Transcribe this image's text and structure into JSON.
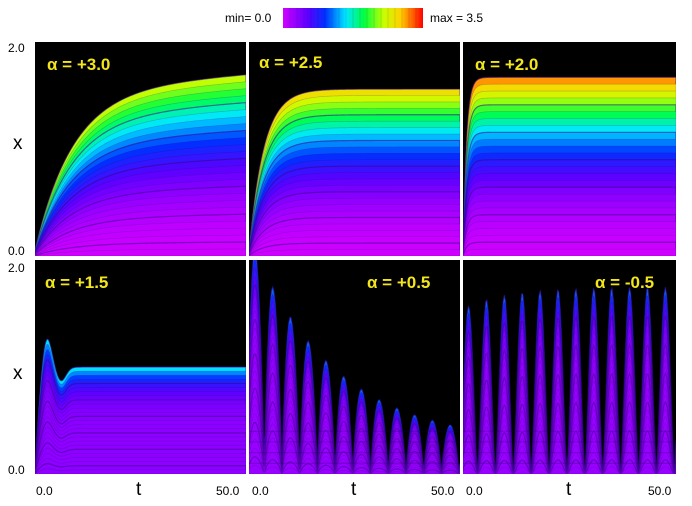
{
  "colorbar": {
    "min_label": "min= 0.0",
    "max_label": "max = 3.5",
    "min": 0.0,
    "max": 3.5,
    "colormap": "rainbow"
  },
  "chart_data": {
    "type": "heatmap",
    "layout": "2x3 grid of panels",
    "xlabel": "t",
    "ylabel": "x",
    "xlim": [
      0.0,
      50.0
    ],
    "ylim": [
      0.0,
      2.0
    ],
    "x_tick_labels": [
      "0.0",
      "50.0"
    ],
    "y_tick_labels": [
      "0.0",
      "2.0"
    ],
    "background_color": "#000000",
    "panels": [
      {
        "title": "α = +3.0",
        "alpha": 3.0,
        "behavior": "monotone growth",
        "steady_top_x": 1.55,
        "max_value": 2.3
      },
      {
        "title": "α = +2.5",
        "alpha": 2.5,
        "behavior": "monotone growth",
        "steady_top_x": 1.55,
        "max_value": 2.6
      },
      {
        "title": "α = +2.0",
        "alpha": 2.0,
        "behavior": "rapid saturation",
        "steady_top_x": 1.67,
        "max_value": 2.9
      },
      {
        "title": "α = +1.5",
        "alpha": 1.5,
        "behavior": "overshoot then damped",
        "peak_x": 1.35,
        "steady_top_x": 1.0,
        "max_value": 1.8
      },
      {
        "title": "α = +0.5",
        "alpha": 0.5,
        "behavior": "decaying oscillation",
        "peak_x": 1.95,
        "max_value": 1.2
      },
      {
        "title": "α = -0.5",
        "alpha": -0.5,
        "behavior": "sustained oscillation",
        "peak_x": 1.75,
        "max_value": 1.2
      }
    ]
  }
}
